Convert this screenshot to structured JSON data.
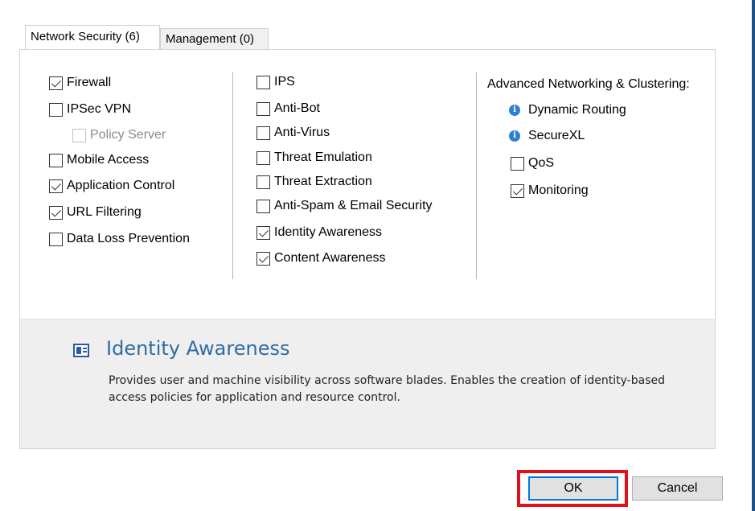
{
  "tabs": [
    {
      "label": "Network Security (6)",
      "active": true
    },
    {
      "label": "Management (0)",
      "active": false
    }
  ],
  "columns": {
    "left": [
      {
        "label": "Firewall",
        "checked": true
      },
      {
        "label": "IPSec VPN",
        "checked": false
      },
      {
        "label": "Policy Server",
        "checked": false,
        "disabled": true
      },
      {
        "label": "Mobile Access",
        "checked": false
      },
      {
        "label": "Application Control",
        "checked": true
      },
      {
        "label": "URL Filtering",
        "checked": true
      },
      {
        "label": "Data Loss Prevention",
        "checked": false
      }
    ],
    "middle": [
      {
        "label": "IPS",
        "checked": false
      },
      {
        "label": "Anti-Bot",
        "checked": false
      },
      {
        "label": "Anti-Virus",
        "checked": false
      },
      {
        "label": "Threat Emulation",
        "checked": false
      },
      {
        "label": "Threat Extraction",
        "checked": false
      },
      {
        "label": "Anti-Spam & Email Security",
        "checked": false
      },
      {
        "label": "Identity Awareness",
        "checked": true
      },
      {
        "label": "Content Awareness",
        "checked": true
      }
    ],
    "right": {
      "heading": "Advanced Networking & Clustering:",
      "info_items": [
        {
          "label": "Dynamic Routing",
          "icon": "info-icon"
        },
        {
          "label": "SecureXL",
          "icon": "info-icon"
        }
      ],
      "items": [
        {
          "label": "QoS",
          "checked": false
        },
        {
          "label": "Monitoring",
          "checked": true
        }
      ]
    }
  },
  "description": {
    "icon": "identity-card-icon",
    "title": "Identity Awareness",
    "text": "Provides user and machine visibility across software blades. Enables the creation of identity-based access policies for application and resource control."
  },
  "buttons": {
    "ok_label": "OK",
    "cancel_label": "Cancel"
  },
  "colors": {
    "accent": "#0078d7",
    "highlight": "#e3101b",
    "title_blue": "#2e6da4",
    "info_blue": "#2f7fd1"
  }
}
